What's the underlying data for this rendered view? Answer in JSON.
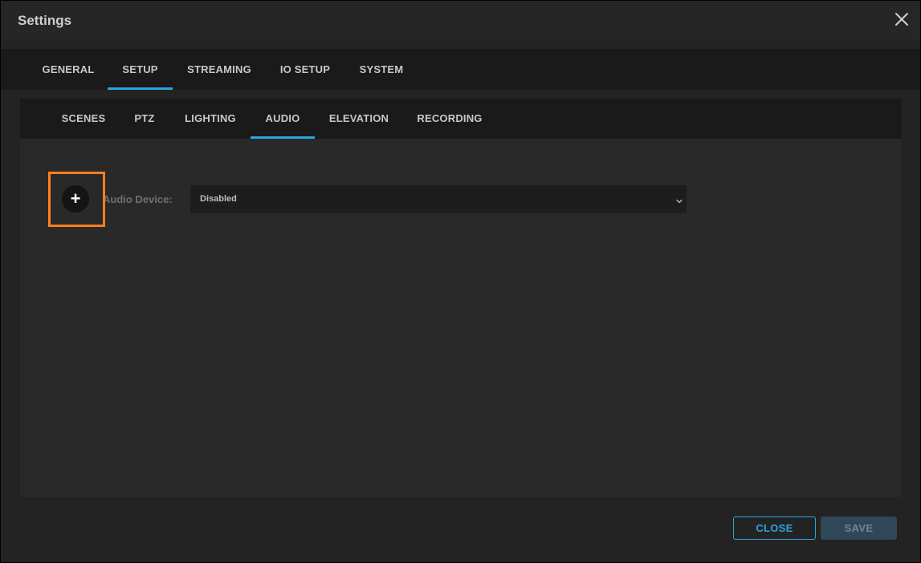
{
  "dialog": {
    "title": "Settings",
    "close_icon": "close-icon"
  },
  "main_tabs": [
    {
      "label": "GENERAL",
      "active": false
    },
    {
      "label": "SETUP",
      "active": true
    },
    {
      "label": "STREAMING",
      "active": false
    },
    {
      "label": "IO SETUP",
      "active": false
    },
    {
      "label": "SYSTEM",
      "active": false
    }
  ],
  "sub_tabs": [
    {
      "label": "SCENES",
      "active": false
    },
    {
      "label": "PTZ",
      "active": false
    },
    {
      "label": "LIGHTING",
      "active": false
    },
    {
      "label": "AUDIO",
      "active": true
    },
    {
      "label": "ELEVATION",
      "active": false
    },
    {
      "label": "RECORDING",
      "active": false
    }
  ],
  "audio": {
    "add_label": "+",
    "device_label": "Audio Device:",
    "device_value": "Disabled"
  },
  "footer": {
    "close_label": "CLOSE",
    "save_label": "SAVE"
  },
  "colors": {
    "accent": "#2aa4de",
    "highlight": "#ff7f1f",
    "save_bg": "#2f4756"
  }
}
